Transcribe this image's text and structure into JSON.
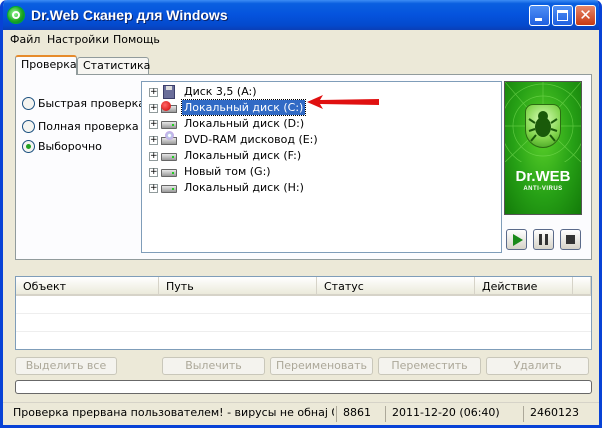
{
  "window": {
    "title": "Dr.Web Сканер для Windows"
  },
  "menu": [
    "Файл",
    "Настройки",
    "Помощь"
  ],
  "tabs": [
    {
      "label": "Проверка",
      "active": true
    },
    {
      "label": "Статистика",
      "active": false
    }
  ],
  "scan_modes": [
    {
      "label": "Быстрая проверка",
      "selected": false
    },
    {
      "label": "Полная проверка",
      "selected": false
    },
    {
      "label": "Выборочно",
      "selected": true
    }
  ],
  "drives": [
    {
      "label": "Диск 3,5 (A:)",
      "icon": "floppy-icon"
    },
    {
      "label": "Локальный диск (C:)",
      "icon": "scan-drive-icon",
      "selected": true
    },
    {
      "label": "Локальный диск (D:)",
      "icon": "hard-drive-icon"
    },
    {
      "label": "DVD-RAM дисковод (E:)",
      "icon": "dvd-drive-icon"
    },
    {
      "label": "Локальный диск (F:)",
      "icon": "hard-drive-icon"
    },
    {
      "label": "Новый том (G:)",
      "icon": "hard-drive-icon"
    },
    {
      "label": "Локальный диск (H:)",
      "icon": "hard-drive-icon"
    }
  ],
  "logo": {
    "text": "Dr.WEB",
    "sub": "ANTI-VIRUS"
  },
  "results_columns": [
    "Объект",
    "Путь",
    "Статус",
    "Действие"
  ],
  "actions": [
    "Выделить все",
    "Вылечить",
    "Переименовать",
    "Переместить",
    "Удалить"
  ],
  "status": {
    "message": "Проверка прервана пользователем! - вирусы не обнаj 0",
    "count": "8861",
    "datetime": "2011-12-20 (06:40)",
    "id": "2460123"
  },
  "progress": 0,
  "colors": {
    "accent": "#0553dd",
    "selection": "#316ac5",
    "arrow": "#e01010",
    "logo_green": "#27a116"
  }
}
